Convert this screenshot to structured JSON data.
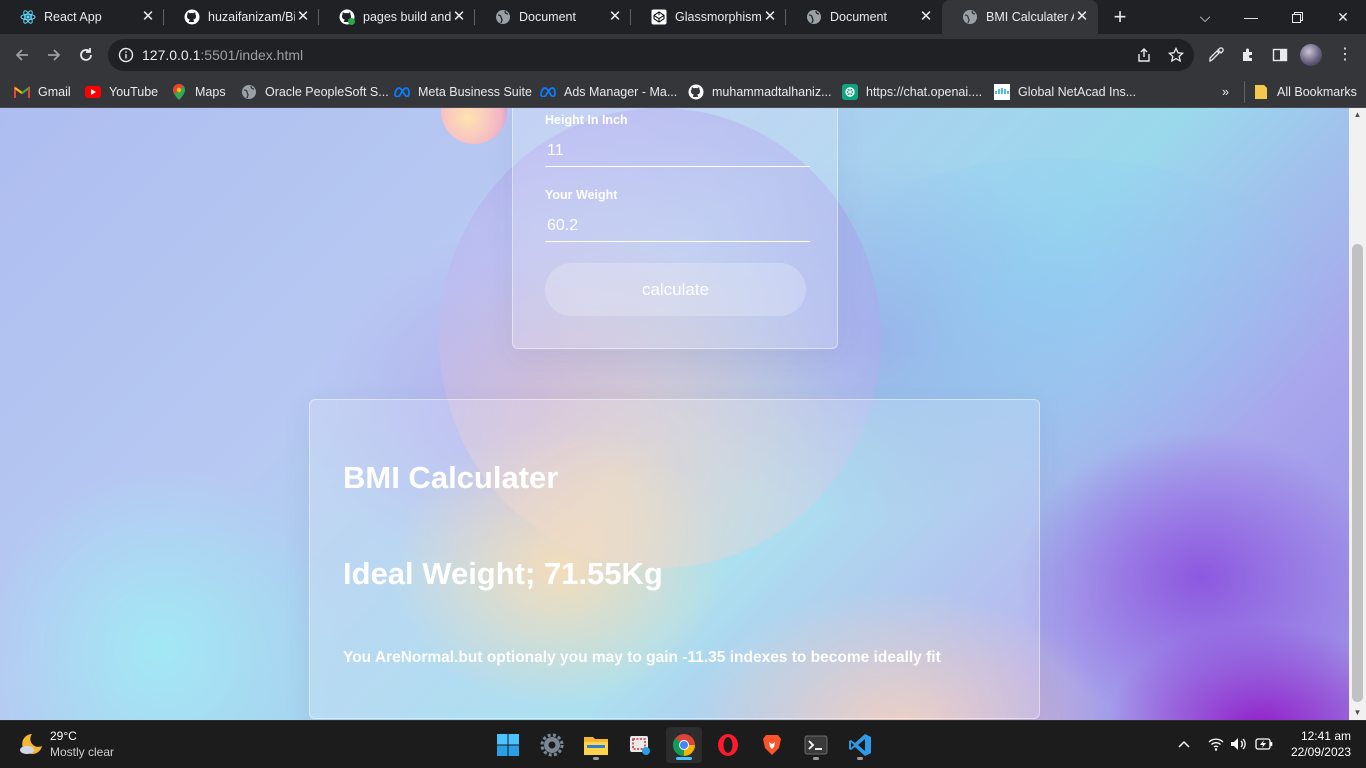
{
  "browser": {
    "tabs": [
      {
        "title": "React App",
        "icon": "react-icon"
      },
      {
        "title": "huzaifanizam/Birth",
        "icon": "github-icon"
      },
      {
        "title": "pages build and deployment",
        "icon": "github-check-icon"
      },
      {
        "title": "Document",
        "icon": "globe-icon"
      },
      {
        "title": "Glassmorphism UI",
        "icon": "codepen-icon"
      },
      {
        "title": "Document",
        "icon": "globe-icon"
      },
      {
        "title": "BMI Calculater App",
        "icon": "globe-icon",
        "active": true
      }
    ],
    "url_host": "127.0.0.1",
    "url_rest": ":5501/index.html",
    "bookmarks": [
      {
        "label": "Gmail",
        "icon": "gmail-icon"
      },
      {
        "label": "YouTube",
        "icon": "youtube-icon"
      },
      {
        "label": "Maps",
        "icon": "maps-icon"
      },
      {
        "label": "Oracle PeopleSoft S...",
        "icon": "globe-icon"
      },
      {
        "label": "Meta Business Suite",
        "icon": "meta-icon"
      },
      {
        "label": "Ads Manager - Ma...",
        "icon": "meta-icon"
      },
      {
        "label": "muhammadtalhaniz...",
        "icon": "github-icon"
      },
      {
        "label": "https://chat.openai....",
        "icon": "openai-icon"
      },
      {
        "label": "Global NetAcad Ins...",
        "icon": "cisco-icon"
      }
    ],
    "all_bookmarks": "All Bookmarks",
    "more": "»"
  },
  "form": {
    "height_inch_label": "Height In Inch",
    "height_inch_value": "11",
    "weight_label": "Your Weight",
    "weight_value": "60.2",
    "calculate_label": "calculate"
  },
  "result": {
    "title": "BMI Calculater",
    "ideal_weight": "Ideal Weight; 71.55Kg",
    "message": "You AreNormal.but optionaly you may to gain -11.35 indexes to become ideally fit"
  },
  "taskbar": {
    "temperature": "29°C",
    "condition": "Mostly clear",
    "time": "12:41 am",
    "date": "22/09/2023"
  },
  "colors": {
    "chrome_dark": "#202124",
    "chrome_toolbar": "#35363a",
    "accent": "#4cc2ff"
  }
}
